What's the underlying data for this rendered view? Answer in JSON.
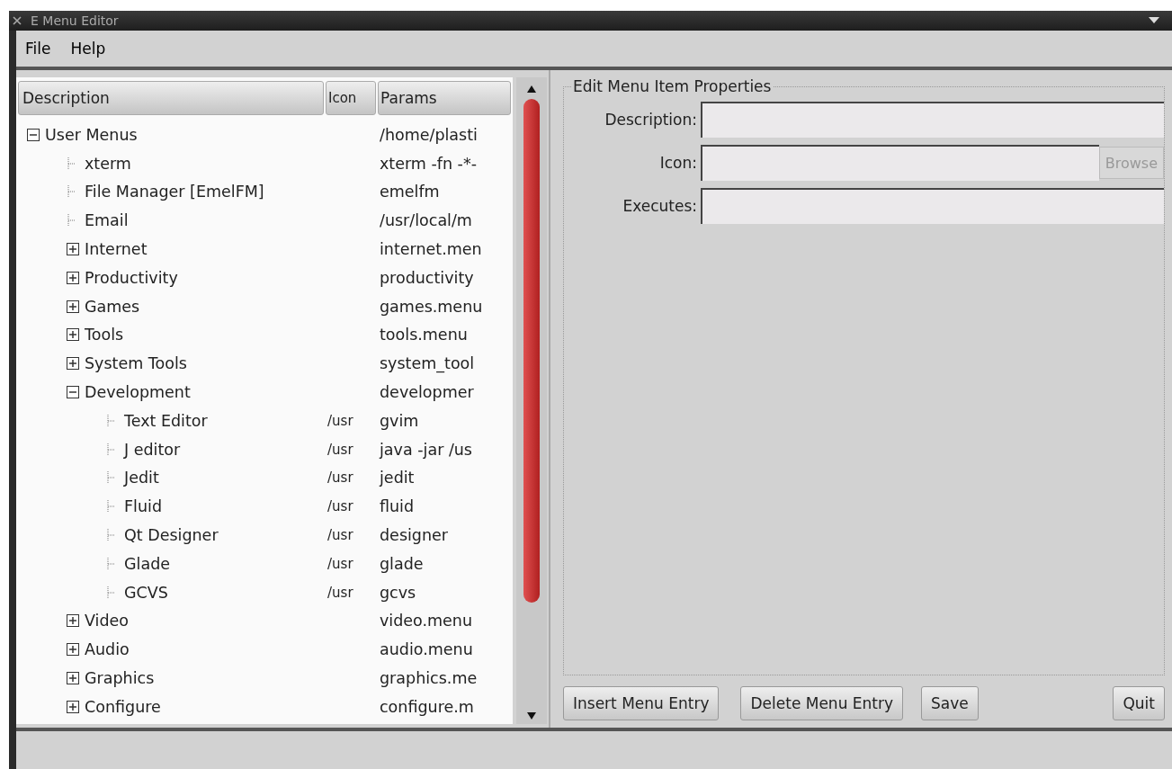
{
  "window": {
    "title": "E Menu Editor"
  },
  "menu": [
    "File",
    "Help"
  ],
  "tree": {
    "columns": [
      "Description",
      "Icon",
      "Params"
    ],
    "rows": [
      {
        "kind": "folder",
        "label": "User Menus",
        "icon": "",
        "params": "/home/plasti",
        "expanded": true,
        "children": [
          {
            "kind": "item",
            "label": "xterm",
            "params": "xterm -fn -*-"
          },
          {
            "kind": "item",
            "label": "File Manager [EmelFM]",
            "params": "emelfm"
          },
          {
            "kind": "item",
            "label": "Email",
            "params": "/usr/local/m"
          },
          {
            "kind": "folder",
            "label": "Internet",
            "params": "internet.men",
            "expanded": false
          },
          {
            "kind": "folder",
            "label": "Productivity",
            "params": "productivity",
            "expanded": false
          },
          {
            "kind": "folder",
            "label": "Games",
            "params": "games.menu",
            "expanded": false
          },
          {
            "kind": "folder",
            "label": "Tools",
            "params": "tools.menu",
            "expanded": false
          },
          {
            "kind": "folder",
            "label": "System Tools",
            "params": "system_tool",
            "expanded": false
          },
          {
            "kind": "folder",
            "label": "Development",
            "params": "developmer",
            "expanded": true,
            "children": [
              {
                "kind": "item",
                "label": "Text Editor",
                "icon": "/usr",
                "params": "gvim"
              },
              {
                "kind": "item",
                "label": "J editor",
                "icon": "/usr",
                "params": "java -jar /us"
              },
              {
                "kind": "item",
                "label": "Jedit",
                "icon": "/usr",
                "params": "jedit"
              },
              {
                "kind": "item",
                "label": "Fluid",
                "icon": "/usr",
                "params": "fluid"
              },
              {
                "kind": "item",
                "label": "Qt Designer",
                "icon": "/usr",
                "params": "designer"
              },
              {
                "kind": "item",
                "label": "Glade",
                "icon": "/usr",
                "params": "glade"
              },
              {
                "kind": "item",
                "label": "GCVS",
                "icon": "/usr",
                "params": "gcvs"
              }
            ]
          },
          {
            "kind": "folder",
            "label": "Video",
            "params": "video.menu",
            "expanded": false
          },
          {
            "kind": "folder",
            "label": "Audio",
            "params": "audio.menu",
            "expanded": false
          },
          {
            "kind": "folder",
            "label": "Graphics",
            "params": "graphics.me",
            "expanded": false
          },
          {
            "kind": "folder",
            "label": "Configure",
            "params": "configure.m",
            "expanded": false
          }
        ]
      }
    ]
  },
  "properties": {
    "title": "Edit Menu Item Properties",
    "fields": [
      {
        "label": "Description:"
      },
      {
        "label": "Icon:",
        "button": {
          "label": "Browse",
          "disabled": true
        }
      },
      {
        "label": "Executes:"
      }
    ]
  },
  "buttons": [
    "Insert Menu Entry",
    "Delete Menu Entry",
    "Save",
    "Quit"
  ]
}
